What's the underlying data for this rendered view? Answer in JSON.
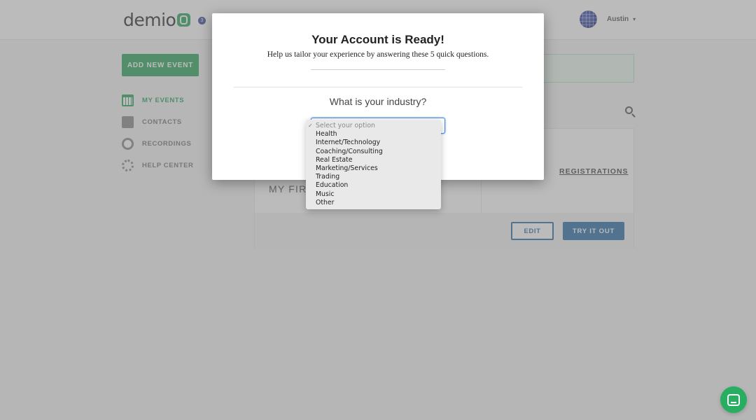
{
  "app": {
    "logo": "demio",
    "notification_count": "3"
  },
  "user": {
    "name": "Austin"
  },
  "sidebar": {
    "add_button": "ADD NEW EVENT",
    "items": [
      {
        "label": "MY EVENTS",
        "icon": "calendar-icon",
        "active": true
      },
      {
        "label": "CONTACTS",
        "icon": "contact-icon",
        "active": false
      },
      {
        "label": "RECORDINGS",
        "icon": "record-icon",
        "active": false
      },
      {
        "label": "HELP CENTER",
        "icon": "lifebuoy-icon",
        "active": false
      }
    ]
  },
  "event": {
    "title": "MY FIRST EMIO",
    "registrations_link": "REGISTRATIONS",
    "edit_label": "EDIT",
    "try_label": "TRY IT OUT"
  },
  "modal": {
    "title": "Your Account is Ready!",
    "subtitle": "Help us tailor your experience by answering these 5 quick questions.",
    "question": "What is your industry?",
    "select": {
      "placeholder": "Select your option",
      "options": [
        "Health",
        "Internet/Technology",
        "Coaching/Consulting",
        "Real Estate",
        "Marketing/Services",
        "Trading",
        "Education",
        "Music",
        "Other"
      ]
    }
  },
  "colors": {
    "brand_green": "#2aa55b",
    "primary_blue": "#2c6ea7",
    "focus_blue": "#4a90e2"
  }
}
